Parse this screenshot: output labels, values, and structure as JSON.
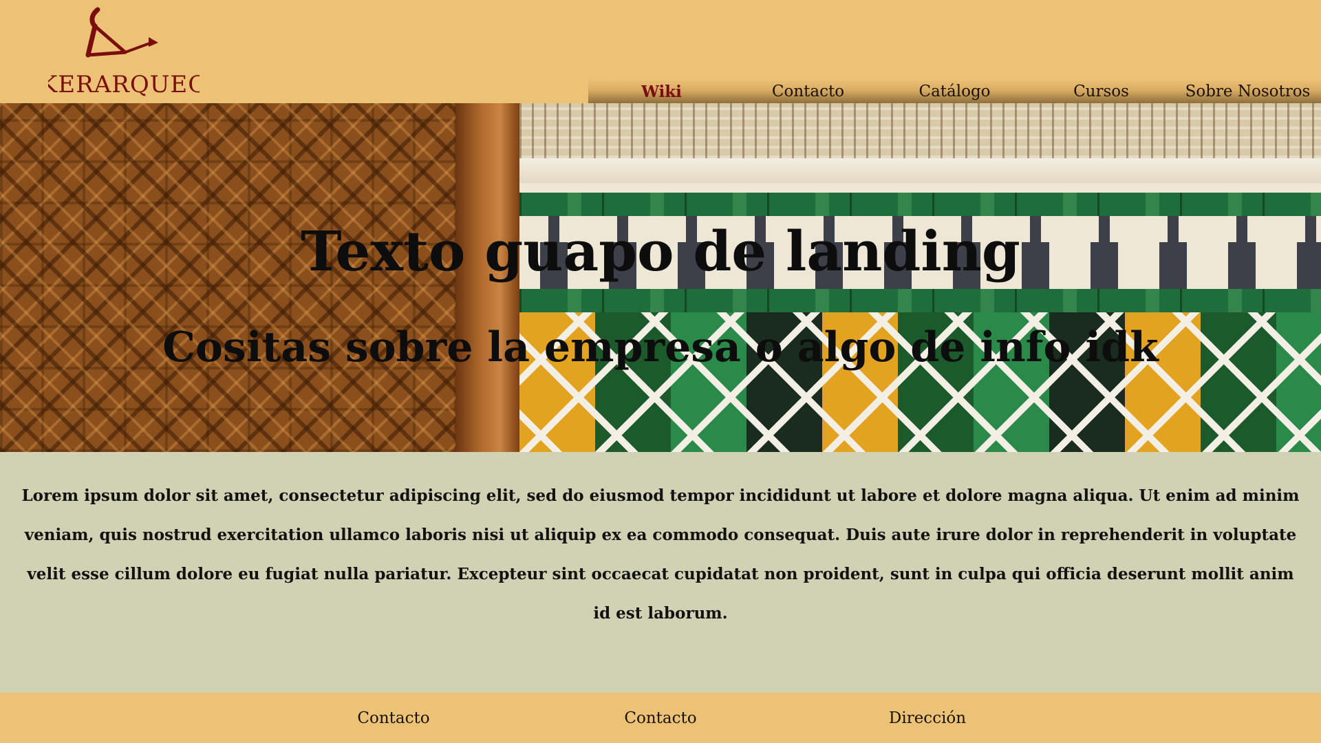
{
  "brand": {
    "logo_text": "KERARQUEO",
    "logo_color": "#7a0d0d"
  },
  "nav": {
    "items": [
      {
        "label": "Wiki",
        "active": true
      },
      {
        "label": "Contacto",
        "active": false
      },
      {
        "label": "Catálogo",
        "active": false
      },
      {
        "label": "Cursos",
        "active": false
      },
      {
        "label": "Sobre Nosotros",
        "active": false
      }
    ]
  },
  "hero": {
    "title": "Texto guapo de landing",
    "subtitle": "Cositas sobre la empresa o algo de info idk"
  },
  "content": {
    "body": "Lorem ipsum dolor sit amet, consectetur adipiscing elit, sed do eiusmod tempor incididunt ut labore et dolore magna aliqua. Ut enim ad minim veniam, quis nostrud exercitation ullamco laboris nisi ut aliquip ex ea commodo consequat. Duis aute irure dolor in reprehenderit in voluptate velit esse cillum dolore eu fugiat nulla pariatur. Excepteur sint occaecat cupidatat non proident, sunt in culpa qui officia deserunt mollit anim id est laborum."
  },
  "footer": {
    "items": [
      {
        "label": "Contacto"
      },
      {
        "label": "Contacto"
      },
      {
        "label": "Dirección"
      }
    ]
  },
  "colors": {
    "header_bg": "#ecc277",
    "content_bg": "#d1d1b3",
    "active_nav": "#7a0d0d"
  }
}
